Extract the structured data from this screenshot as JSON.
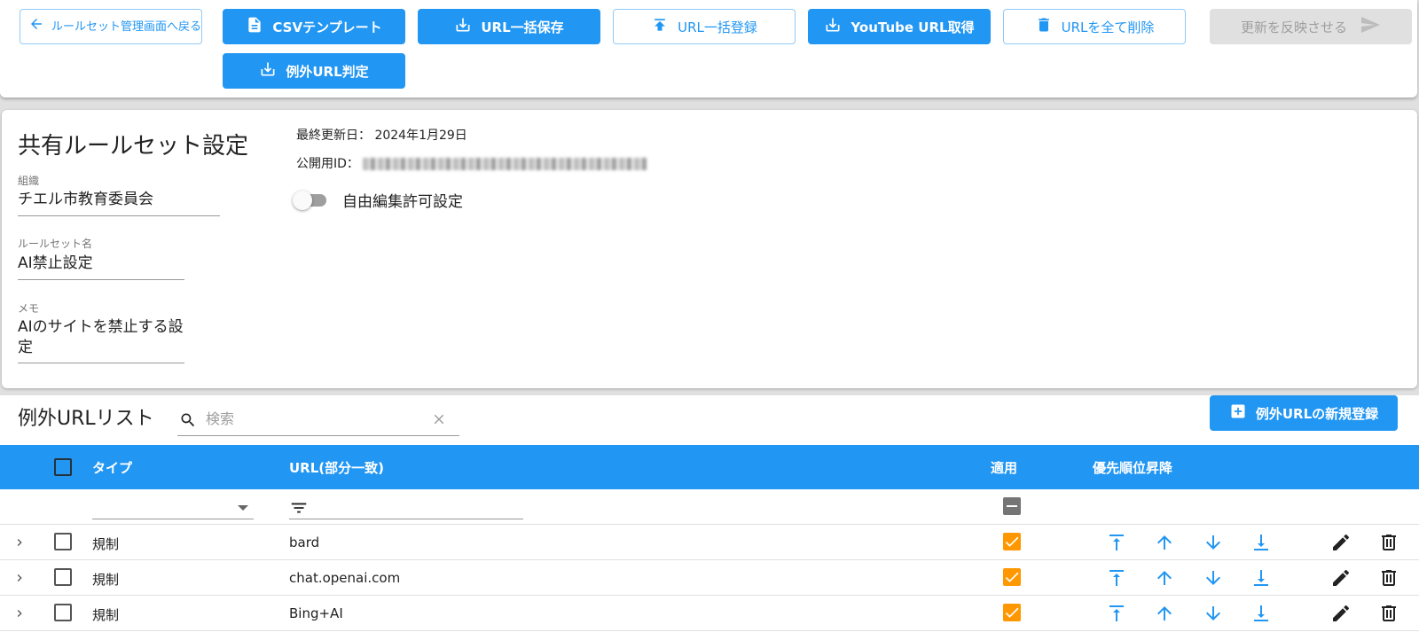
{
  "toolbar": {
    "back_label": "ルールセット管理画面へ戻る",
    "csv_template": "CSVテンプレート",
    "url_bulk_save": "URL一括保存",
    "url_bulk_register": "URL一括登録",
    "youtube_url": "YouTube URL取得",
    "delete_all": "URLを全て削除",
    "apply_changes": "更新を反映させる",
    "exception_url": "例外URL判定"
  },
  "settings": {
    "title": "共有ルールセット設定",
    "last_updated_label": "最終更新日：",
    "last_updated_value": "2024年1月29日",
    "public_id_label": "公開用ID：",
    "free_edit_label": "自由編集許可設定",
    "free_edit_enabled": false,
    "org_label": "組織",
    "org_value": "チエル市教育委員会",
    "ruleset_label": "ルールセット名",
    "ruleset_value": "AI禁止設定",
    "memo_label": "メモ",
    "memo_value": "AIのサイトを禁止する設定"
  },
  "list": {
    "title": "例外URLリスト",
    "search_placeholder": "検索",
    "add_button": "例外URLの新規登録",
    "columns": {
      "type": "タイプ",
      "url": "URL(部分一致)",
      "apply": "適用",
      "priority": "優先順位昇降"
    },
    "rows": [
      {
        "type": "規制",
        "url": "bard",
        "applied": true
      },
      {
        "type": "規制",
        "url": "chat.openai.com",
        "applied": true
      },
      {
        "type": "規制",
        "url": "Bing+AI",
        "applied": true
      }
    ]
  },
  "colors": {
    "primary": "#2196f3",
    "check_orange": "#ff9800",
    "disabled": "#e0e0e0"
  },
  "icons": {
    "back": "arrow-left-icon",
    "csv": "file-icon",
    "download": "download-icon",
    "upload": "upload-icon",
    "trash": "trash-icon",
    "send": "send-icon",
    "search": "search-icon",
    "clear": "close-icon",
    "add": "plus-box-icon",
    "filter": "filter-icon",
    "expand": "chevron-right-icon",
    "top": "arrow-top-icon",
    "up": "arrow-up-icon",
    "down": "arrow-down-icon",
    "bottom": "arrow-bottom-icon",
    "edit": "pencil-icon",
    "delete": "trash-icon"
  }
}
